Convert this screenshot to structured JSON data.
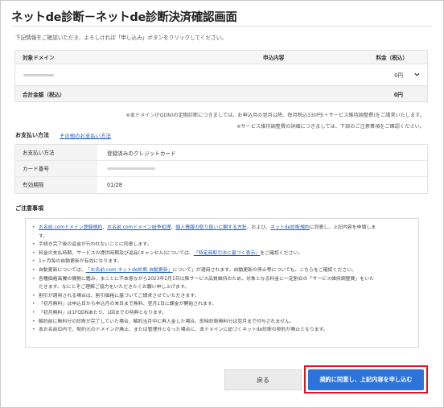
{
  "page": {
    "title": "ネットde診断－ネットde診断決済確認画面",
    "lead": "下記情報をご確認いただき、よろしければ「申し込み」ボタンをクリックしてください。"
  },
  "summary": {
    "headers": {
      "domain": "対象ドメイン",
      "content": "申込内容",
      "fee": "料金（税込）"
    },
    "item": {
      "fee": "0円"
    },
    "total": {
      "label": "合計金額（税込）",
      "value": "0円"
    }
  },
  "notes": {
    "fqdn": "※本ドメイン(FQDN)の定期診断につきましては、お申込月の翌月以降、毎月税込330円(＋サービス維持調整費)をご請求いたします。",
    "fee_adjust": "※サービス維持調整費の詳細につきましては、下部のご注意事項をご確認ください。"
  },
  "payment": {
    "title": "お支払い方法",
    "other_link": "その他のお支払い方法",
    "rows": [
      {
        "label": "お支払い方法",
        "value": "登録済みのクレジットカード"
      },
      {
        "label": "カード番号",
        "value": ""
      },
      {
        "label": "有効期限",
        "value": "01/28"
      }
    ]
  },
  "caution": {
    "title": "ご注意事項",
    "l1_pre": "",
    "l1_a1": "お名前.comドメイン登録規約",
    "l1_s1": "、",
    "l1_a2": "お名前.comドメイン紛争処理",
    "l1_s2": "、",
    "l1_a3": "個人情報の取り扱いに関する方針",
    "l1_s3": "、および、",
    "l1_a4": "ネットde診断規約",
    "l1_post": "に同意し、上記内容を申請しま",
    "l1_cont": "す。",
    "l2": "手続き完了後の返金が行われないことに同意します。",
    "l3_pre": "料金の支払時期、サービスの提供時期及び返品(キャンセル)については、",
    "l3_a": "「特定商取引法に基づく表示」",
    "l3_post": "をご確認ください。",
    "l4": "1ヶ月毎の自動更新が有効になります。",
    "l5_pre": "自動更新については、",
    "l5_a": "「お名前.com ネットde診断 自動更新」",
    "l5_post": "について」が適用されます。自動更新の停止等についても、こちらをご確認ください。",
    "l6": "各種価格高騰の情勢に鑑み、まことに不本意ながら2023年2月1日以降サービス品質維持のため、対象となる料金に一定割合の「サービス維持調整費」をいた",
    "l6_cont": "だきます。なにとぞご理解ご協力をいただきたくお願い申し上げます。",
    "l7": "割引が適用される場合は、割引価格に基づいてご請求させていただきます。",
    "l8": "「初月無料」は申込日から申込月の末日まで無料、翌月1日に課金が開始されます。",
    "l9": "「初月無料」は1FQDNあたり、1回までの特典となります。",
    "l10": "解約前に無料分の診断が完了していた場合、解約当月中に再入金した場合、即時診断無料分は翌月まで付与されません。",
    "l11": "本お名前ID内で、契約元のドメインが廃止、または管理外となった場合に、本ドメインに紐づくネットde診断の契約が廃止となります。"
  },
  "buttons": {
    "back": "戻る",
    "agree": "規約に同意し、上記内容を申し込む"
  },
  "colors": {
    "accent": "#2c74d9",
    "highlight": "#e0141e",
    "link": "#1a58b8"
  }
}
